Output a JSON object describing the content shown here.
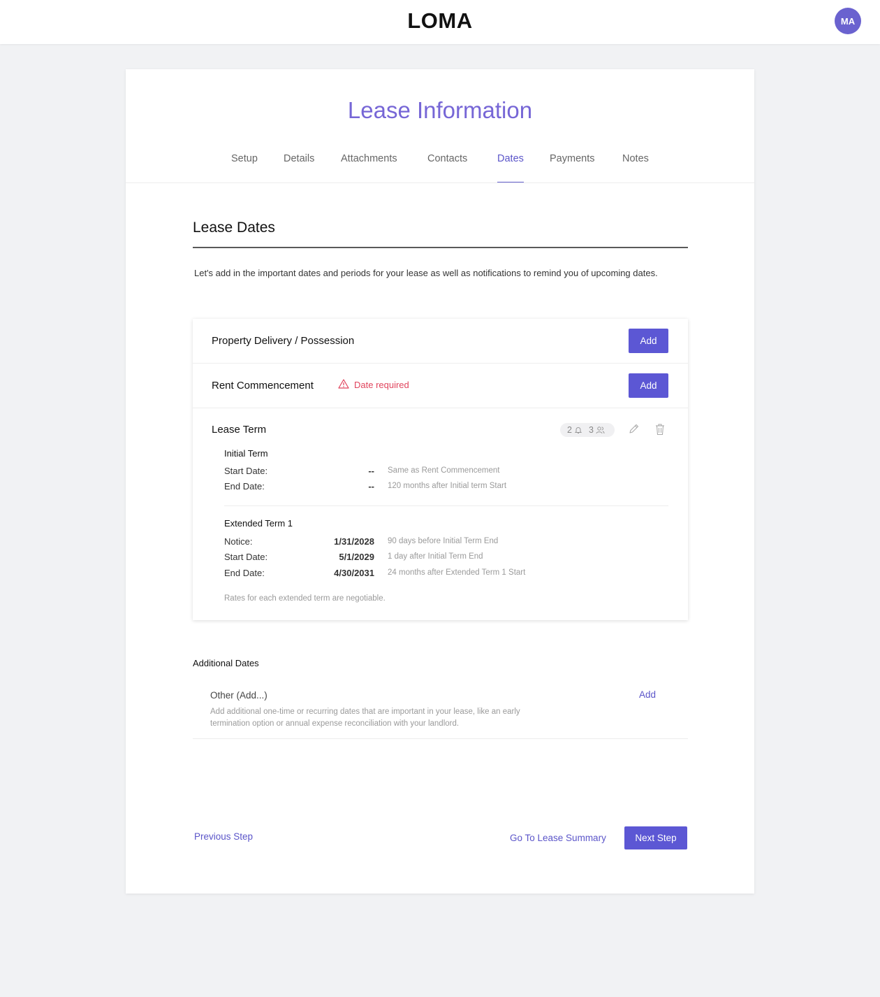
{
  "app": {
    "logo": "LOMA",
    "avatar_initials": "MA"
  },
  "page": {
    "title": "Lease Information",
    "tabs": [
      {
        "label": "Setup"
      },
      {
        "label": "Details"
      },
      {
        "label": "Attachments"
      },
      {
        "label": "Contacts"
      },
      {
        "label": "Dates",
        "active": true
      },
      {
        "label": "Payments"
      },
      {
        "label": "Notes"
      }
    ]
  },
  "section": {
    "title": "Lease Dates",
    "intro": "Let's add in the important dates and periods for your lease as well as notifications to remind you of upcoming dates."
  },
  "delivery": {
    "title": "Property Delivery / Possession",
    "button": "Add"
  },
  "rent": {
    "title": "Rent Commencement",
    "warning": "Date required",
    "button": "Add"
  },
  "lease_term": {
    "title": "Lease Term",
    "notification_count": "2",
    "contact_count": "3",
    "initial": {
      "title": "Initial Term",
      "rows": [
        {
          "label": "Start Date:",
          "value": "--",
          "note": "Same as Rent Commencement"
        },
        {
          "label": "End Date:",
          "value": "--",
          "note": "120 months after Initial term Start"
        }
      ]
    },
    "extended": {
      "title": "Extended Term 1",
      "rows": [
        {
          "label": "Notice:",
          "value": "1/31/2028",
          "note": "90 days before Initial Term End"
        },
        {
          "label": "Start Date:",
          "value": "5/1/2029",
          "note": "1 day after Initial Term End"
        },
        {
          "label": "End Date:",
          "value": "4/30/2031",
          "note": "24 months after Extended Term 1 Start"
        }
      ]
    },
    "footnote": "Rates for each extended term are negotiable."
  },
  "additional": {
    "title": "Additional Dates",
    "other_title": "Other (Add...)",
    "other_desc": "Add additional one-time or recurring dates that are important in your lease, like an early termination option or annual expense reconciliation with your landlord.",
    "other_add": "Add"
  },
  "footer": {
    "previous": "Previous Step",
    "summary": "Go To Lease Summary",
    "next": "Next Step"
  },
  "colors": {
    "accent": "#5c57d4",
    "title": "#7666d6",
    "warning": "#e1445d"
  }
}
